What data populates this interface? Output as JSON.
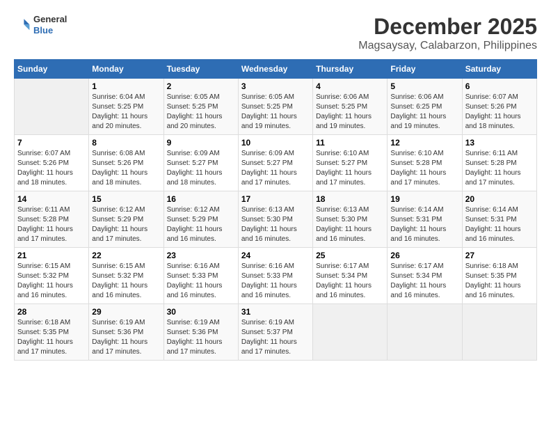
{
  "header": {
    "logo": {
      "line1": "General",
      "line2": "Blue"
    },
    "title": "December 2025",
    "subtitle": "Magsaysay, Calabarzon, Philippines"
  },
  "days_of_week": [
    "Sunday",
    "Monday",
    "Tuesday",
    "Wednesday",
    "Thursday",
    "Friday",
    "Saturday"
  ],
  "weeks": [
    [
      {
        "day": "",
        "empty": true
      },
      {
        "day": "1",
        "sunrise": "6:04 AM",
        "sunset": "5:25 PM",
        "daylight": "11 hours and 20 minutes."
      },
      {
        "day": "2",
        "sunrise": "6:05 AM",
        "sunset": "5:25 PM",
        "daylight": "11 hours and 20 minutes."
      },
      {
        "day": "3",
        "sunrise": "6:05 AM",
        "sunset": "5:25 PM",
        "daylight": "11 hours and 19 minutes."
      },
      {
        "day": "4",
        "sunrise": "6:06 AM",
        "sunset": "5:25 PM",
        "daylight": "11 hours and 19 minutes."
      },
      {
        "day": "5",
        "sunrise": "6:06 AM",
        "sunset": "6:25 PM",
        "daylight": "11 hours and 19 minutes."
      },
      {
        "day": "6",
        "sunrise": "6:07 AM",
        "sunset": "5:26 PM",
        "daylight": "11 hours and 18 minutes."
      }
    ],
    [
      {
        "day": "7",
        "sunrise": "6:07 AM",
        "sunset": "5:26 PM",
        "daylight": "11 hours and 18 minutes."
      },
      {
        "day": "8",
        "sunrise": "6:08 AM",
        "sunset": "5:26 PM",
        "daylight": "11 hours and 18 minutes."
      },
      {
        "day": "9",
        "sunrise": "6:09 AM",
        "sunset": "5:27 PM",
        "daylight": "11 hours and 18 minutes."
      },
      {
        "day": "10",
        "sunrise": "6:09 AM",
        "sunset": "5:27 PM",
        "daylight": "11 hours and 17 minutes."
      },
      {
        "day": "11",
        "sunrise": "6:10 AM",
        "sunset": "5:27 PM",
        "daylight": "11 hours and 17 minutes."
      },
      {
        "day": "12",
        "sunrise": "6:10 AM",
        "sunset": "5:28 PM",
        "daylight": "11 hours and 17 minutes."
      },
      {
        "day": "13",
        "sunrise": "6:11 AM",
        "sunset": "5:28 PM",
        "daylight": "11 hours and 17 minutes."
      }
    ],
    [
      {
        "day": "14",
        "sunrise": "6:11 AM",
        "sunset": "5:28 PM",
        "daylight": "11 hours and 17 minutes."
      },
      {
        "day": "15",
        "sunrise": "6:12 AM",
        "sunset": "5:29 PM",
        "daylight": "11 hours and 17 minutes."
      },
      {
        "day": "16",
        "sunrise": "6:12 AM",
        "sunset": "5:29 PM",
        "daylight": "11 hours and 16 minutes."
      },
      {
        "day": "17",
        "sunrise": "6:13 AM",
        "sunset": "5:30 PM",
        "daylight": "11 hours and 16 minutes."
      },
      {
        "day": "18",
        "sunrise": "6:13 AM",
        "sunset": "5:30 PM",
        "daylight": "11 hours and 16 minutes."
      },
      {
        "day": "19",
        "sunrise": "6:14 AM",
        "sunset": "5:31 PM",
        "daylight": "11 hours and 16 minutes."
      },
      {
        "day": "20",
        "sunrise": "6:14 AM",
        "sunset": "5:31 PM",
        "daylight": "11 hours and 16 minutes."
      }
    ],
    [
      {
        "day": "21",
        "sunrise": "6:15 AM",
        "sunset": "5:32 PM",
        "daylight": "11 hours and 16 minutes."
      },
      {
        "day": "22",
        "sunrise": "6:15 AM",
        "sunset": "5:32 PM",
        "daylight": "11 hours and 16 minutes."
      },
      {
        "day": "23",
        "sunrise": "6:16 AM",
        "sunset": "5:33 PM",
        "daylight": "11 hours and 16 minutes."
      },
      {
        "day": "24",
        "sunrise": "6:16 AM",
        "sunset": "5:33 PM",
        "daylight": "11 hours and 16 minutes."
      },
      {
        "day": "25",
        "sunrise": "6:17 AM",
        "sunset": "5:34 PM",
        "daylight": "11 hours and 16 minutes."
      },
      {
        "day": "26",
        "sunrise": "6:17 AM",
        "sunset": "5:34 PM",
        "daylight": "11 hours and 16 minutes."
      },
      {
        "day": "27",
        "sunrise": "6:18 AM",
        "sunset": "5:35 PM",
        "daylight": "11 hours and 16 minutes."
      }
    ],
    [
      {
        "day": "28",
        "sunrise": "6:18 AM",
        "sunset": "5:35 PM",
        "daylight": "11 hours and 17 minutes."
      },
      {
        "day": "29",
        "sunrise": "6:19 AM",
        "sunset": "5:36 PM",
        "daylight": "11 hours and 17 minutes."
      },
      {
        "day": "30",
        "sunrise": "6:19 AM",
        "sunset": "5:36 PM",
        "daylight": "11 hours and 17 minutes."
      },
      {
        "day": "31",
        "sunrise": "6:19 AM",
        "sunset": "5:37 PM",
        "daylight": "11 hours and 17 minutes."
      },
      {
        "day": "",
        "empty": true
      },
      {
        "day": "",
        "empty": true
      },
      {
        "day": "",
        "empty": true
      }
    ]
  ],
  "labels": {
    "sunrise_prefix": "Sunrise: ",
    "sunset_prefix": "Sunset: ",
    "daylight_prefix": "Daylight: "
  }
}
